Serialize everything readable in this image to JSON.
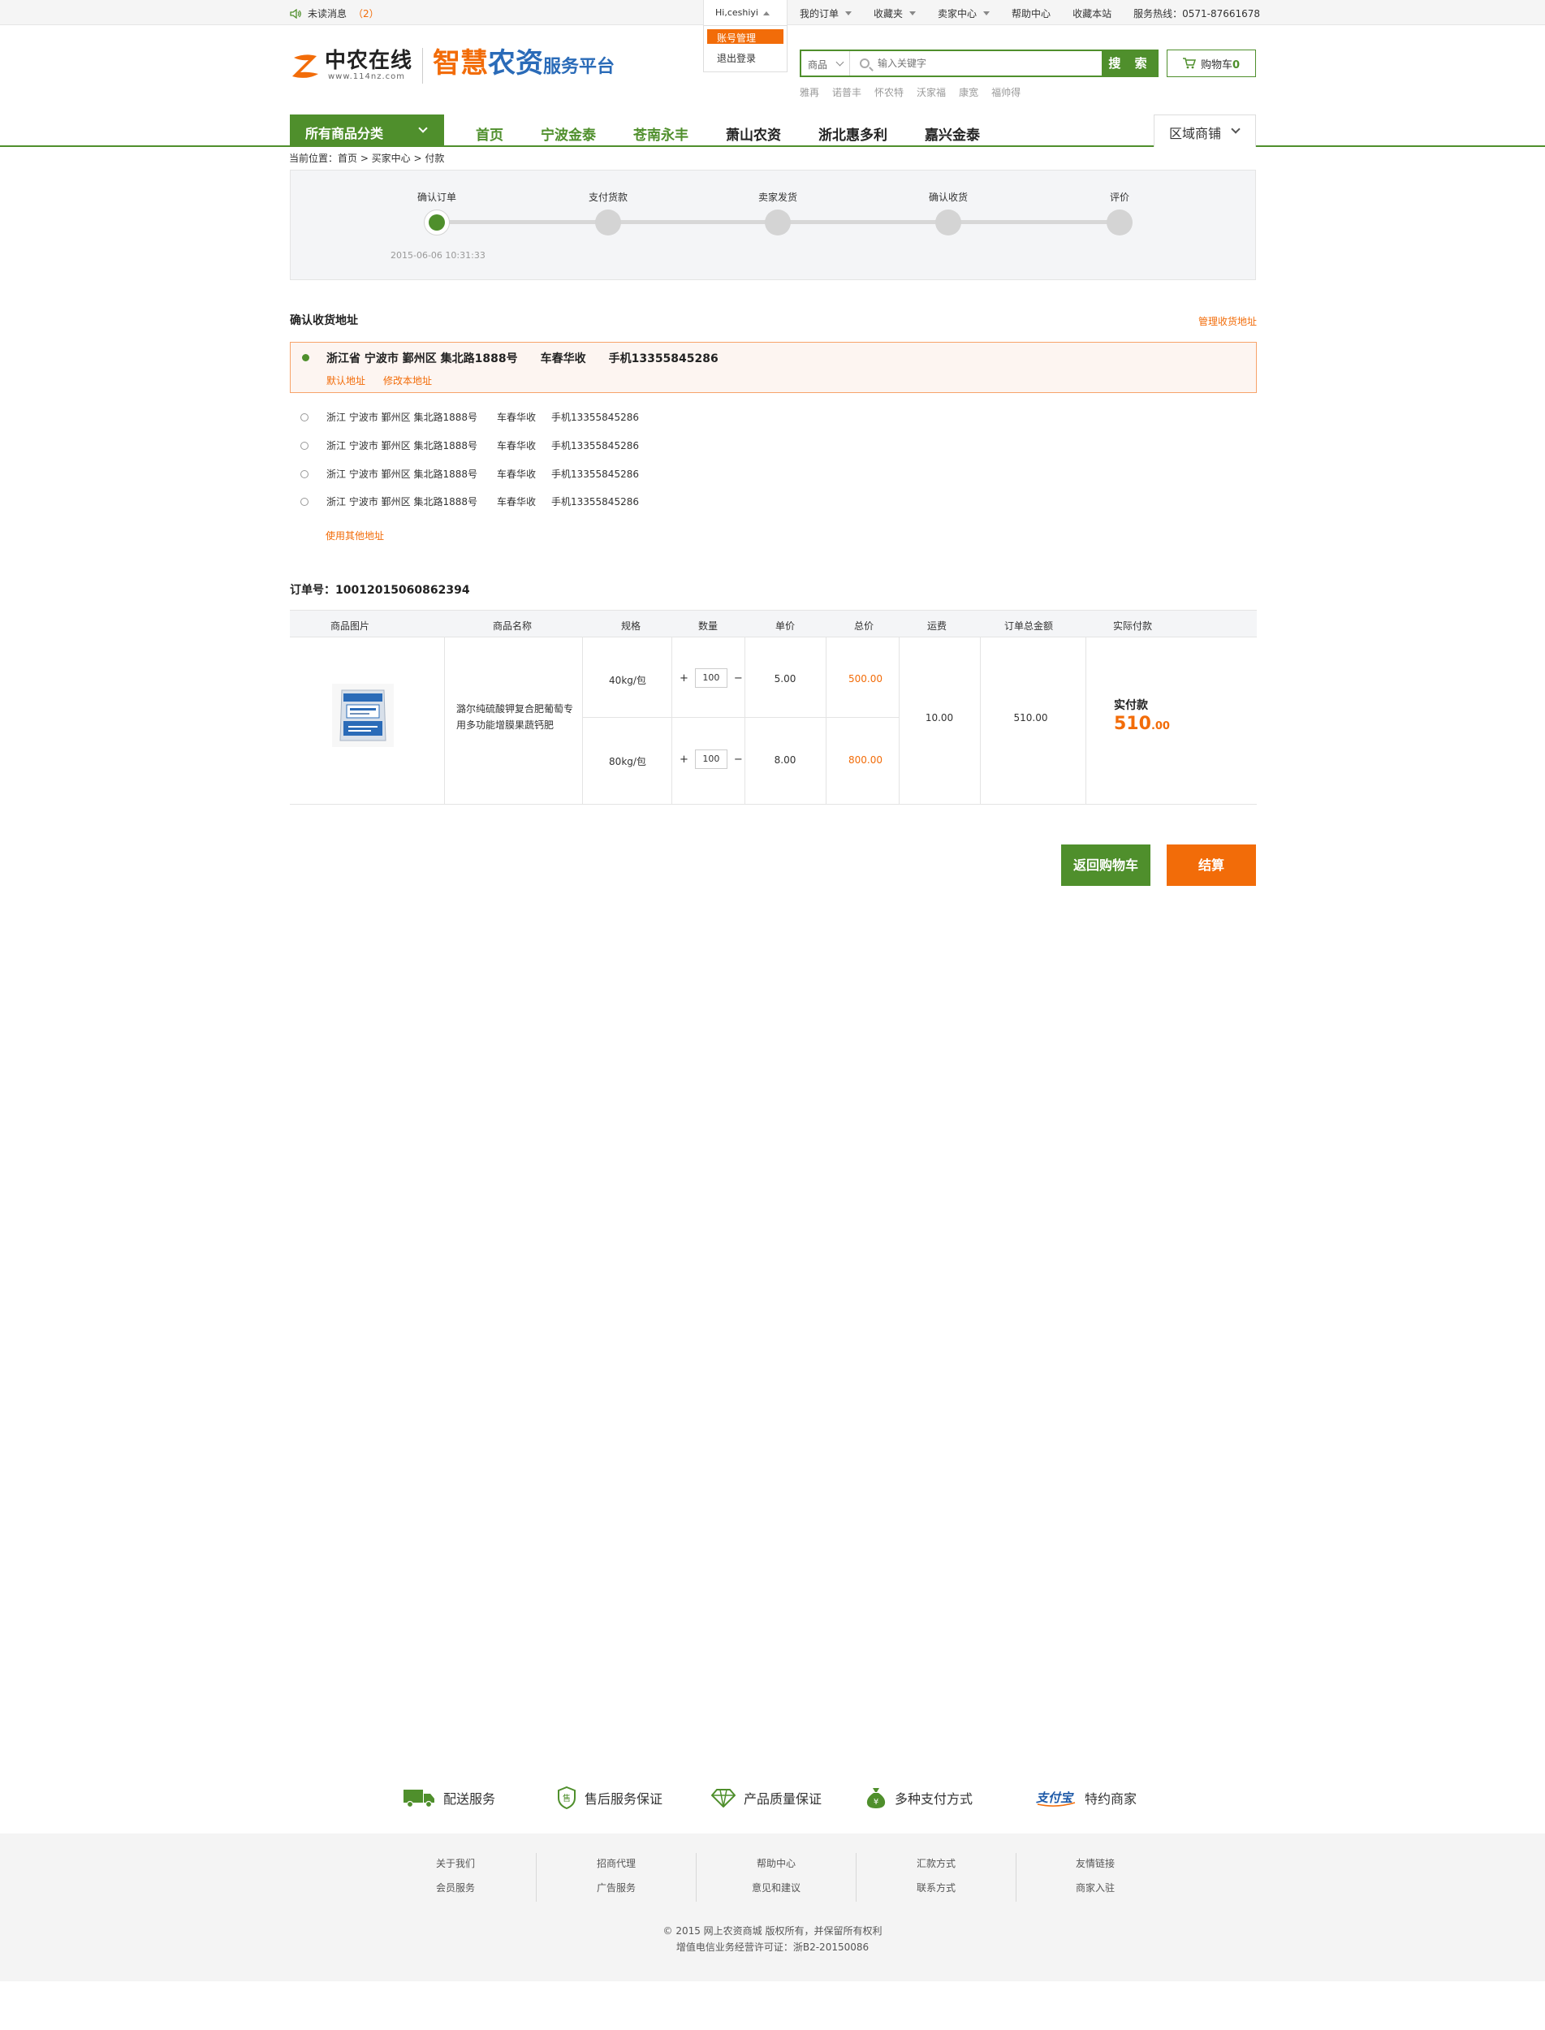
{
  "topbar": {
    "unread_label": "未读消息",
    "unread_count": "（2）",
    "user_greeting": "Hi,ceshiyi",
    "user_menu": [
      "账号管理",
      "退出登录"
    ],
    "links": [
      "我的订单",
      "收藏夹",
      "卖家中心",
      "帮助中心",
      "收藏本站"
    ],
    "hotline": "服务热线：0571-87661678"
  },
  "header": {
    "logo_name": "中农在线",
    "logo_url": "www.114nz.com",
    "logo_sub_a": "智慧",
    "logo_sub_b": "农资",
    "logo_sub_c": "服务平台",
    "search_category": "商品",
    "search_placeholder": "输入关键字",
    "search_button": "搜 索",
    "hotwords": [
      "雅再",
      "诺普丰",
      "怀农特",
      "沃家福",
      "康宽",
      "福帅得"
    ],
    "cart_label": "购物车",
    "cart_count": "0"
  },
  "nav": {
    "all_categories": "所有商品分类",
    "links": [
      "首页",
      "宁波金泰",
      "苍南永丰",
      "萧山农资",
      "浙北惠多利",
      "嘉兴金泰"
    ],
    "region": "区域商铺"
  },
  "breadcrumb": "当前位置：首页 > 买家中心 > 付款",
  "progress": {
    "steps": [
      "确认订单",
      "支付货款",
      "卖家发货",
      "确认收货",
      "评价"
    ],
    "timestamp": "2015-06-06  10:31:33"
  },
  "address": {
    "title": "确认收货地址",
    "manage_link": "管理收货地址",
    "selected": {
      "address": "浙江省  宁波市  鄞州区  集北路1888号",
      "name": "车春华收",
      "phone": "手机13355845286",
      "default_label": "默认地址",
      "edit_label": "修改本地址"
    },
    "others": [
      {
        "address": "浙江  宁波市  鄞州区  集北路1888号",
        "name": "车春华收",
        "phone": "手机13355845286"
      },
      {
        "address": "浙江  宁波市  鄞州区  集北路1888号",
        "name": "车春华收",
        "phone": "手机13355845286"
      },
      {
        "address": "浙江  宁波市  鄞州区  集北路1888号",
        "name": "车春华收",
        "phone": "手机13355845286"
      },
      {
        "address": "浙江  宁波市  鄞州区  集北路1888号",
        "name": "车春华收",
        "phone": "手机13355845286"
      }
    ],
    "use_other": "使用其他地址"
  },
  "order": {
    "order_no": "订单号：10012015060862394",
    "headers": [
      "商品图片",
      "商品名称",
      "规格",
      "数量",
      "单价",
      "总价",
      "运费",
      "订单总金额",
      "实际付款"
    ],
    "product_name": "潞尔纯硫酸钾复合肥葡萄专用多功能增膜果蔬钙肥",
    "rows": [
      {
        "spec": "40kg/包",
        "qty": "100",
        "unit_price": "5.00",
        "total": "500.00"
      },
      {
        "spec": "80kg/包",
        "qty": "100",
        "unit_price": "8.00",
        "total": "800.00"
      }
    ],
    "freight": "10.00",
    "order_total": "510.00",
    "pay_label": "实付款",
    "pay_amount_int": "510",
    "pay_amount_dec": ".00",
    "qty_plus": "+",
    "qty_minus": "−"
  },
  "actions": {
    "back_to_cart": "返回购物车",
    "settle": "结算"
  },
  "services": [
    "配送服务",
    "售后服务保证",
    "产品质量保证",
    "多种支付方式",
    "特约商家"
  ],
  "footer": {
    "columns": [
      [
        "关于我们",
        "会员服务"
      ],
      [
        "招商代理",
        "广告服务"
      ],
      [
        "帮助中心",
        "意见和建议"
      ],
      [
        "汇款方式",
        "联系方式"
      ],
      [
        "友情链接",
        "商家入驻"
      ]
    ],
    "copyright": "© 2015  网上农资商城  版权所有，并保留所有权利",
    "license": "增值电信业务经营许可证：浙B2-20150086"
  },
  "colors": {
    "green": "#4f8f2c",
    "orange": "#f26c09",
    "blue": "#2a6bb8"
  },
  "icons": [
    "speaker-icon",
    "search-icon",
    "cart-icon",
    "truck-icon",
    "shield-icon",
    "diamond-icon",
    "money-bag-icon",
    "alipay-logo"
  ]
}
